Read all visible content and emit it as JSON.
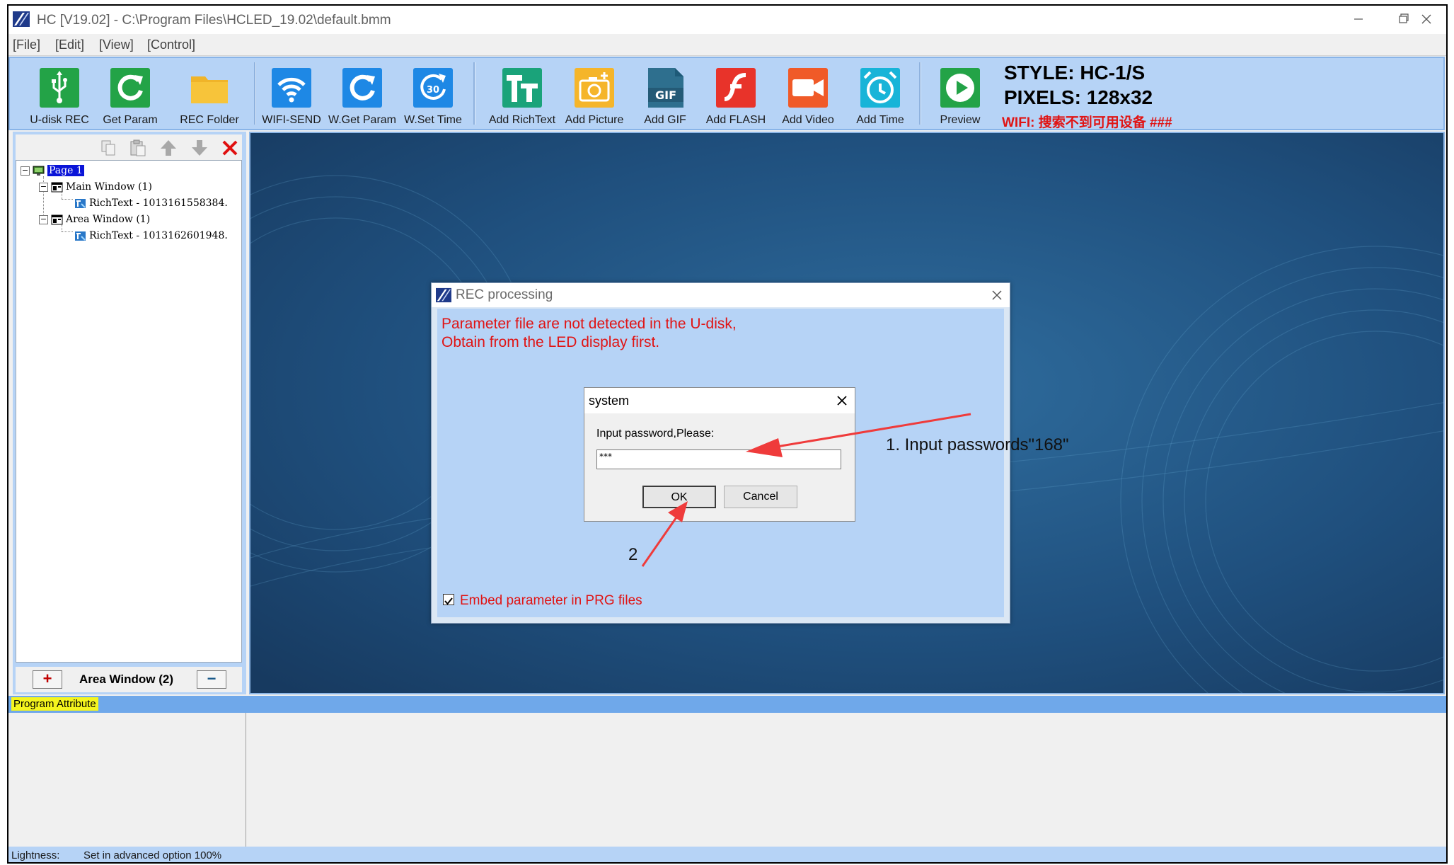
{
  "window": {
    "title": "HC [V19.02] - C:\\Program Files\\HCLED_19.02\\default.bmm",
    "controls": [
      "minimize-icon",
      "restore-icon",
      "close-icon"
    ]
  },
  "menu": [
    "[File]",
    "[Edit]",
    "[View]",
    "[Control]"
  ],
  "toolbar": {
    "buttons": [
      {
        "label": "U-disk REC",
        "icon": "usb-icon",
        "color": "#23a347"
      },
      {
        "label": "Get Param",
        "icon": "refresh-icon",
        "color": "#23a347"
      },
      {
        "label": "REC Folder",
        "icon": "folder-icon",
        "color": "#f0b429"
      },
      {
        "label": "WIFI-SEND",
        "icon": "wifi-icon",
        "color": "#1e88e5"
      },
      {
        "label": "W.Get Param",
        "icon": "refresh-icon",
        "color": "#1e88e5"
      },
      {
        "label": "W.Set Time",
        "icon": "clock-30-icon",
        "color": "#1e88e5"
      },
      {
        "label": "Add RichText",
        "icon": "text-icon",
        "color": "#1aa37a"
      },
      {
        "label": "Add Picture",
        "icon": "camera-icon",
        "color": "#f5b52a"
      },
      {
        "label": "Add GIF",
        "icon": "gif-icon",
        "color": "#2e6f8e"
      },
      {
        "label": "Add FLASH",
        "icon": "flash-icon",
        "color": "#e8332a"
      },
      {
        "label": "Add Video",
        "icon": "video-icon",
        "color": "#f05a28"
      },
      {
        "label": "Add Time",
        "icon": "alarm-clock-icon",
        "color": "#18b4d8"
      },
      {
        "label": "Preview",
        "icon": "play-icon",
        "color": "#23a347"
      }
    ],
    "style": "STYLE: HC-1/S",
    "pixels": "PIXELS: 128x32",
    "wifi": "WIFI: 搜索不到可用设备 ###"
  },
  "tree": {
    "tools": [
      "copy-icon",
      "paste-icon",
      "move-up-icon",
      "move-down-icon",
      "delete-icon"
    ],
    "nodes": [
      {
        "label": "Page 1",
        "selected": true
      },
      {
        "label": "Main Window  (1)"
      },
      {
        "label": "RichText - 1013161558384."
      },
      {
        "label": "Area Window  (1)"
      },
      {
        "label": "RichText - 1013162601948."
      }
    ],
    "area_label": "Area Window (2)",
    "add_symbol": "+",
    "remove_symbol": "−"
  },
  "program_attribute": "Program Attribute",
  "status": {
    "lightness_label": "Lightness:",
    "lightness_value": "Set in advanced option  100%"
  },
  "rec_dialog": {
    "title": "REC processing",
    "message_line1": "Parameter file are not detected in the U-disk,",
    "message_line2": "Obtain from the LED display first.",
    "embed_label": "Embed parameter in PRG files",
    "embed_checked": true
  },
  "system_dialog": {
    "title": "system",
    "prompt": "Input password,Please:",
    "password_value": "***",
    "ok_label": "OK",
    "cancel_label": "Cancel"
  },
  "annotations": {
    "step1": "1. Input passwords\"168\"",
    "step2": "2",
    "arrow_color": "#ef3b3b"
  }
}
